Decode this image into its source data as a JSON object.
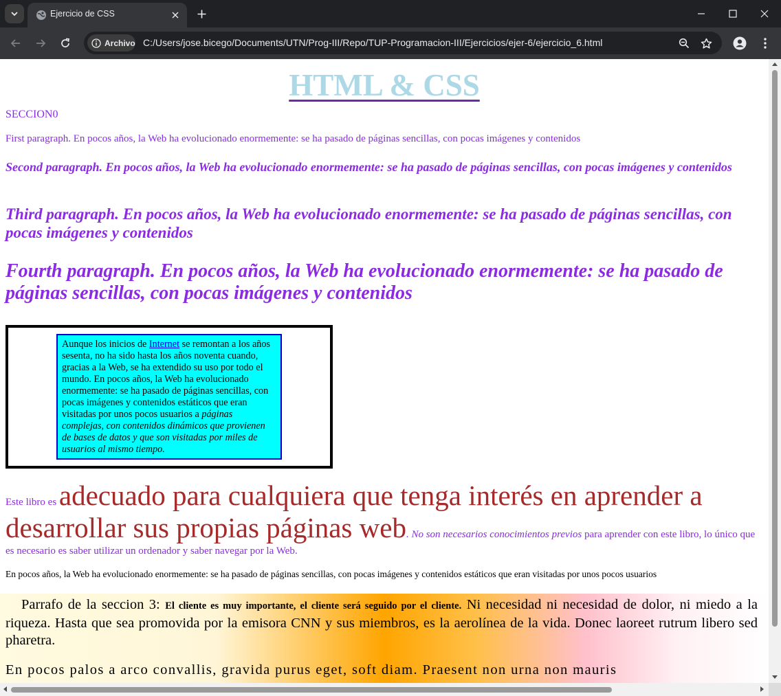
{
  "browser": {
    "tab_title": "Ejercicio de CSS",
    "chip_label": "Archivo",
    "url": "C:/Users/jose.bicego/Documents/UTN/Prog-III/Repo/TUP-Programacion-III/Ejercicios/ejer-6/ejercicio_6.html"
  },
  "page": {
    "heading": "HTML & CSS",
    "section0": "SECCION0",
    "p1": "First paragraph. En pocos años, la Web ha evolucionado enormemente: se ha pasado de páginas sencillas, con pocas imágenes y contenidos",
    "p2": "Second paragraph. En pocos años, la Web ha evolucionado enormemente: se ha pasado de páginas sencillas, con pocas imágenes y contenidos",
    "p3": "Third paragraph. En pocos años, la Web ha evolucionado enormemente: se ha pasado de páginas sencillas, con pocas imágenes y contenidos",
    "p4": "Fourth paragraph. En pocos años, la Web ha evolucionado enormemente: se ha pasado de páginas sencillas, con pocas imágenes y contenidos",
    "box": {
      "before_link": "Aunque los inicios de ",
      "link": "Internet",
      "after_link": " se remontan a los años sesenta, no ha sido hasta los años noventa cuando, gracias a la Web, se ha extendido su uso por todo el mundo. En pocos años, la Web ha evolucionado enormemente: se ha pasado de páginas sencillas, con pocas imágenes y contenidos estáticos que eran visitadas por unos pocos usuarios a ",
      "italic": "páginas complejas, con contenidos dinámicos que provienen de bases de datos y que son visitadas por miles de usuarios al mismo tiempo."
    },
    "libro": {
      "start": "Este libro es ",
      "big": "adecuado para cualquiera que tenga interés en aprender a desarrollar sus propias páginas web",
      "italic": ". No son necesarios conocimientos previos",
      "end": " para aprender con este libro, lo único que es necesario es saber utilizar un ordenador y saber navegar por la Web."
    },
    "plain": "En pocos años, la Web ha evolucionado enormemente: se ha pasado de páginas sencillas, con pocas imágenes y contenidos estáticos que eran visitadas por unos pocos usuarios",
    "sec3": {
      "start": "Parrafo de la seccion 3: ",
      "bold": "El cliente es muy importante, el cliente será seguido por el cliente.",
      "end": " Ni necesidad ni necesidad de dolor, ni miedo a la riqueza. Hasta que sea promovida por la emisora CNN y sus miembros, es la aerolínea de la vida. Donec laoreet rutrum libero sed pharetra.",
      "p2": "En pocos palos a arco convallis, gravida purus eget, soft diam. Praesent non urna non mauris"
    }
  }
}
